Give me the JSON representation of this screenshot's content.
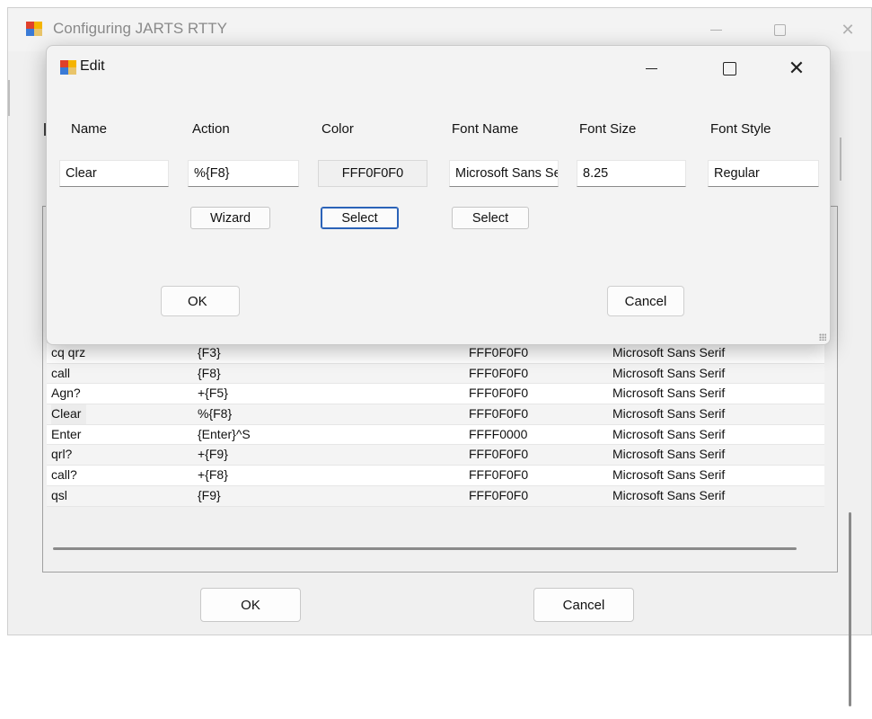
{
  "main_window": {
    "title": "Configuring JARTS RTTY",
    "ok_label": "OK",
    "cancel_label": "Cancel"
  },
  "grid": {
    "rows": [
      {
        "name": "cq qrz",
        "action": "{F3}",
        "color": "FFF0F0F0",
        "font": "Microsoft Sans Serif"
      },
      {
        "name": "call",
        "action": "{F8}",
        "color": "FFF0F0F0",
        "font": "Microsoft Sans Serif"
      },
      {
        "name": "Agn?",
        "action": "+{F5}",
        "color": "FFF0F0F0",
        "font": "Microsoft Sans Serif"
      },
      {
        "name": "Clear",
        "action": "%{F8}",
        "color": "FFF0F0F0",
        "font": "Microsoft Sans Serif"
      },
      {
        "name": "Enter",
        "action": "{Enter}^S",
        "color": "FFFF0000",
        "font": "Microsoft Sans Serif"
      },
      {
        "name": "qrl?",
        "action": "+{F9}",
        "color": "FFF0F0F0",
        "font": "Microsoft Sans Serif"
      },
      {
        "name": "call?",
        "action": "+{F8}",
        "color": "FFF0F0F0",
        "font": "Microsoft Sans Serif"
      },
      {
        "name": "qsl",
        "action": "{F9}",
        "color": "FFF0F0F0",
        "font": "Microsoft Sans Serif"
      }
    ]
  },
  "edit_dialog": {
    "title": "Edit",
    "labels": {
      "name": "Name",
      "action": "Action",
      "color": "Color",
      "font_name": "Font Name",
      "font_size": "Font Size",
      "font_style": "Font Style"
    },
    "values": {
      "name": "Clear",
      "action": "%{F8}",
      "color": "FFF0F0F0",
      "font_name": "Microsoft Sans Serif",
      "font_size": "8.25",
      "font_style": "Regular"
    },
    "buttons": {
      "wizard": "Wizard",
      "color_select": "Select",
      "font_select": "Select",
      "ok": "OK",
      "cancel": "Cancel"
    }
  },
  "icons": {
    "app": "app-window-icon",
    "minimize": "minimize-icon",
    "maximize": "maximize-icon",
    "close": "close-icon"
  }
}
